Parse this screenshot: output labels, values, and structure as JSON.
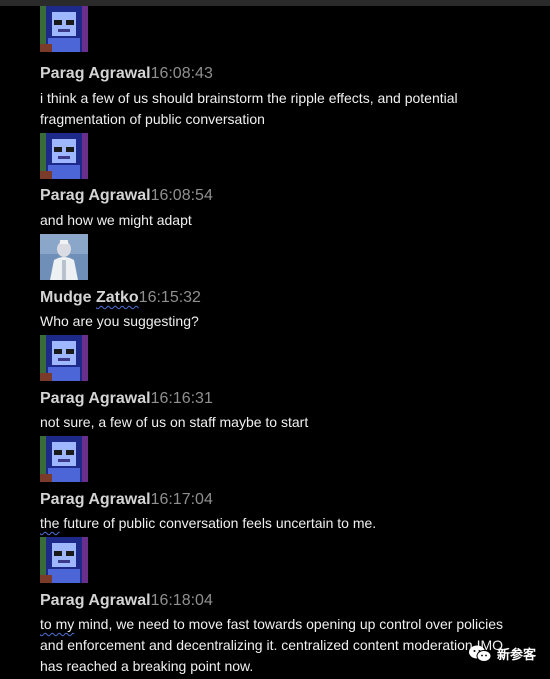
{
  "messages": [
    {
      "author": "Parag Agrawal",
      "time": "16:08:43",
      "text": "i think a few of us should brainstorm the ripple effects, and potential fragmentation of public conversation",
      "avatar": "pixel-avatar-icon"
    },
    {
      "author": "Parag Agrawal",
      "time": "16:08:54",
      "text": "and how we might adapt",
      "avatar": "pixel-avatar-icon"
    },
    {
      "author_first": "Mudge ",
      "author_last": "Zatko",
      "time": "16:15:32",
      "text": "Who are you suggesting?",
      "avatar": "photo-avatar"
    },
    {
      "author": "Parag Agrawal",
      "time": "16:16:31",
      "text": "not sure, a few of us on staff maybe to start",
      "avatar": "pixel-avatar-icon"
    },
    {
      "author": "Parag Agrawal",
      "time": "16:17:04",
      "text_first": "the",
      "text_rest": " future of public conversation feels uncertain to me.",
      "avatar": "pixel-avatar-icon"
    },
    {
      "author": "Parag Agrawal",
      "time": "16:18:04",
      "text_first": "to my",
      "text_rest": " mind, we need to move fast towards opening up control over policies and enforcement and decentralizing it. centralized content moderation IMO has reached a breaking point now.",
      "avatar": "pixel-avatar-icon"
    }
  ],
  "watermark": {
    "label": "新参客",
    "icon": "wechat-icon"
  },
  "colors": {
    "background": "#000000",
    "name": "#d4d4d4",
    "timestamp": "#8f8f8f",
    "spellcheck": "#4b6fd6"
  }
}
